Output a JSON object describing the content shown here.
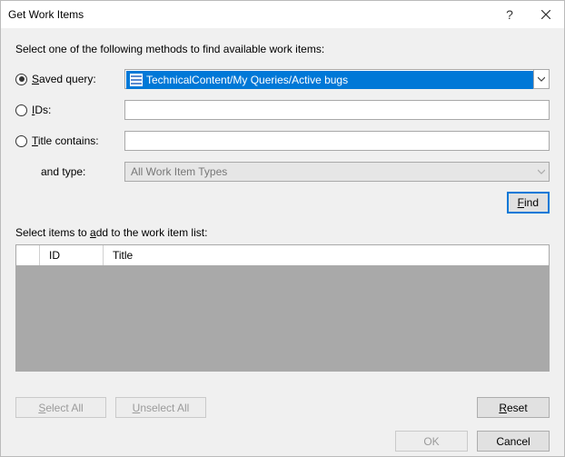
{
  "window": {
    "title": "Get Work Items",
    "help": "?"
  },
  "instruction": "Select one of the following methods to find available work items:",
  "methods": {
    "saved_query": {
      "label_pre": "S",
      "label_post": "aved query:"
    },
    "ids": {
      "label_pre": "I",
      "label_post": "Ds:"
    },
    "title_contains": {
      "label_pre": "T",
      "label_post": "itle contains:"
    },
    "and_type": "and type:"
  },
  "fields": {
    "saved_query_value": "TechnicalContent/My Queries/Active bugs",
    "type_value": "All Work Item Types"
  },
  "buttons": {
    "find_pre": "F",
    "find_post": "ind",
    "select_all_pre": "S",
    "select_all_post": "elect All",
    "unselect_all_pre": "U",
    "unselect_all_post": "nselect All",
    "reset_pre": "R",
    "reset_post": "eset",
    "ok": "OK",
    "cancel": "Cancel"
  },
  "grid": {
    "heading_pre": "Select items to ",
    "heading_u": "a",
    "heading_post": "dd to the work item list:",
    "col_id": "ID",
    "col_title": "Title"
  }
}
